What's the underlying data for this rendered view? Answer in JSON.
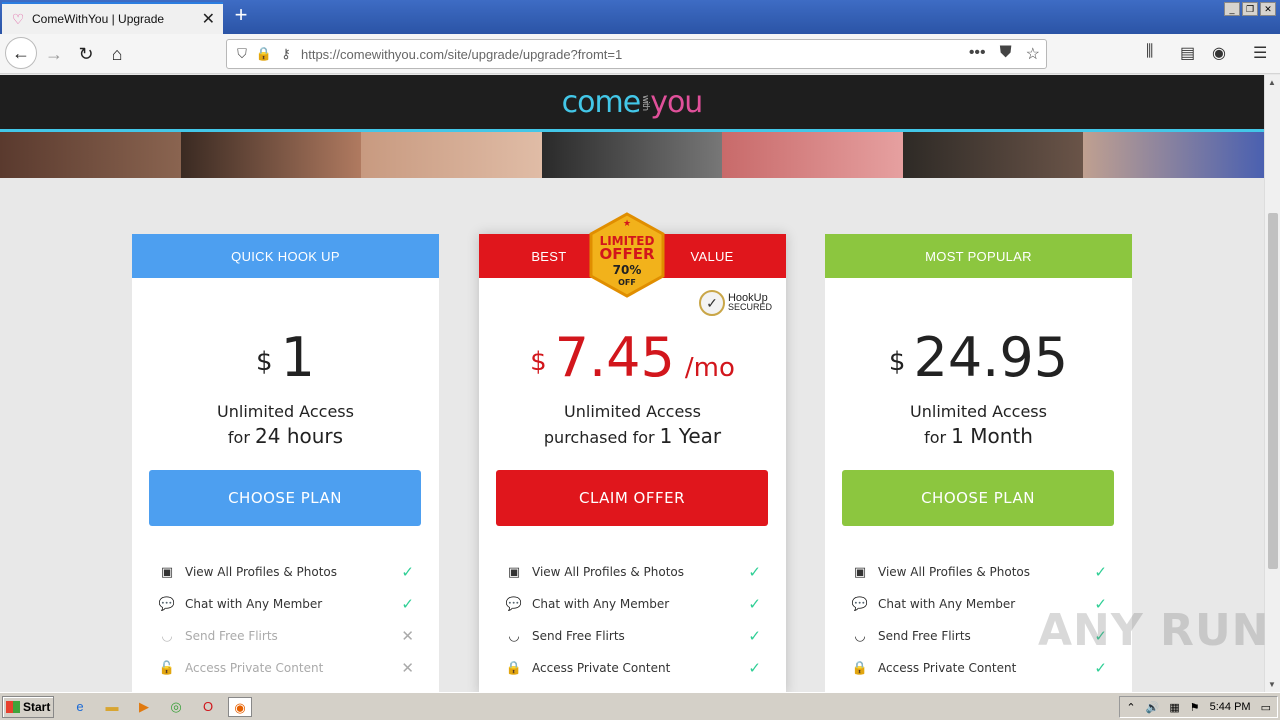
{
  "browser": {
    "tab_title": "ComeWithYou | Upgrade",
    "url_host": "https://comewithyou.com",
    "url_path": "/site/upgrade/upgrade?fromt=1"
  },
  "site": {
    "logo_left": "come",
    "logo_mid": "with",
    "logo_right": "you"
  },
  "plans": [
    {
      "header": "QUICK HOOK UP",
      "color": "#4d9ff0",
      "currency": "$",
      "amount": "1",
      "per": "",
      "desc_line1": "Unlimited Access",
      "desc_prefix": "for",
      "desc_big": "24 hours",
      "cta": "CHOOSE PLAN",
      "features": [
        {
          "label": "View All Profiles & Photos",
          "icon": "profile-icon",
          "included": true
        },
        {
          "label": "Chat with Any Member",
          "icon": "chat-icon",
          "included": true
        },
        {
          "label": "Send Free Flirts",
          "icon": "lips-icon",
          "included": false
        },
        {
          "label": "Access Private Content",
          "icon": "lock-icon",
          "included": false
        }
      ]
    },
    {
      "header_left": "BEST",
      "header_right": "VALUE",
      "color": "#e0161c",
      "badge_line1": "LIMITED",
      "badge_line2": "OFFER",
      "badge_line3": "70%",
      "badge_line4": "OFF",
      "secured_line1": "HookUp",
      "secured_line2": "SECURED",
      "currency": "$",
      "amount": "7.45",
      "per": "/mo",
      "desc_line1": "Unlimited Access",
      "desc_prefix": "purchased for",
      "desc_big": "1 Year",
      "cta": "CLAIM OFFER",
      "features": [
        {
          "label": "View All Profiles & Photos",
          "icon": "profile-icon",
          "included": true
        },
        {
          "label": "Chat with Any Member",
          "icon": "chat-icon",
          "included": true
        },
        {
          "label": "Send Free Flirts",
          "icon": "lips-icon",
          "included": true
        },
        {
          "label": "Access Private Content",
          "icon": "lock-icon",
          "included": true
        }
      ]
    },
    {
      "header": "MOST POPULAR",
      "color": "#8cc63f",
      "currency": "$",
      "amount": "24.95",
      "per": "",
      "desc_line1": "Unlimited Access",
      "desc_prefix": "for",
      "desc_big": "1 Month",
      "cta": "CHOOSE PLAN",
      "features": [
        {
          "label": "View All Profiles & Photos",
          "icon": "profile-icon",
          "included": true
        },
        {
          "label": "Chat with Any Member",
          "icon": "chat-icon",
          "included": true
        },
        {
          "label": "Send Free Flirts",
          "icon": "lips-icon",
          "included": true
        },
        {
          "label": "Access Private Content",
          "icon": "lock-icon",
          "included": true
        }
      ]
    }
  ],
  "taskbar": {
    "start_label": "Start",
    "clock": "5:44 PM"
  },
  "watermark": "ANY RUN"
}
